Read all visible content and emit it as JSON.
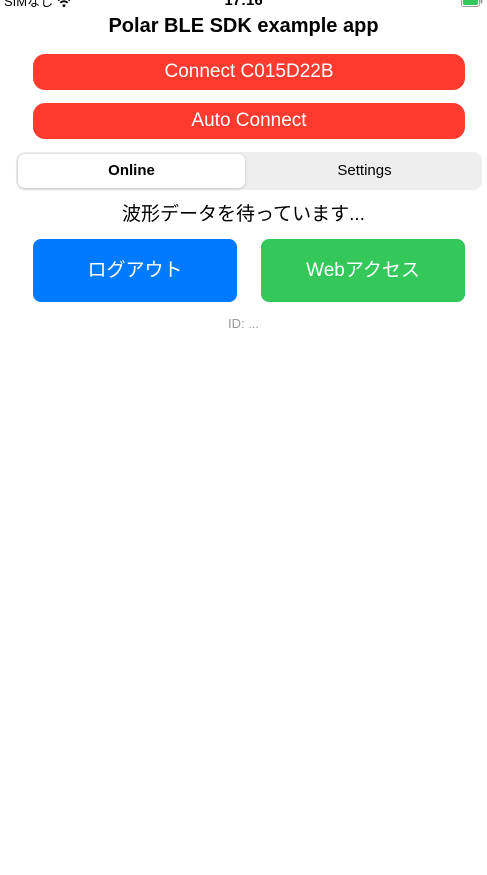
{
  "status_bar": {
    "carrier": "SIMなし",
    "time": "17:16",
    "wifi_icon": "wifi-icon",
    "battery_icon": "battery-charging-icon",
    "battery_color": "#34c759"
  },
  "header": {
    "title": "Polar BLE SDK example app"
  },
  "buttons": {
    "connect_label": "Connect C015D22B",
    "auto_connect_label": "Auto Connect",
    "logout_label": "ログアウト",
    "web_access_label": "Webアクセス"
  },
  "tabs": [
    {
      "label": "Online",
      "selected": true
    },
    {
      "label": "Settings",
      "selected": false
    }
  ],
  "main": {
    "status_text": "波形データを待っています...",
    "id_text": "ID: ..."
  },
  "colors": {
    "red": "#ff3b30",
    "blue": "#007aff",
    "green": "#34c759"
  }
}
